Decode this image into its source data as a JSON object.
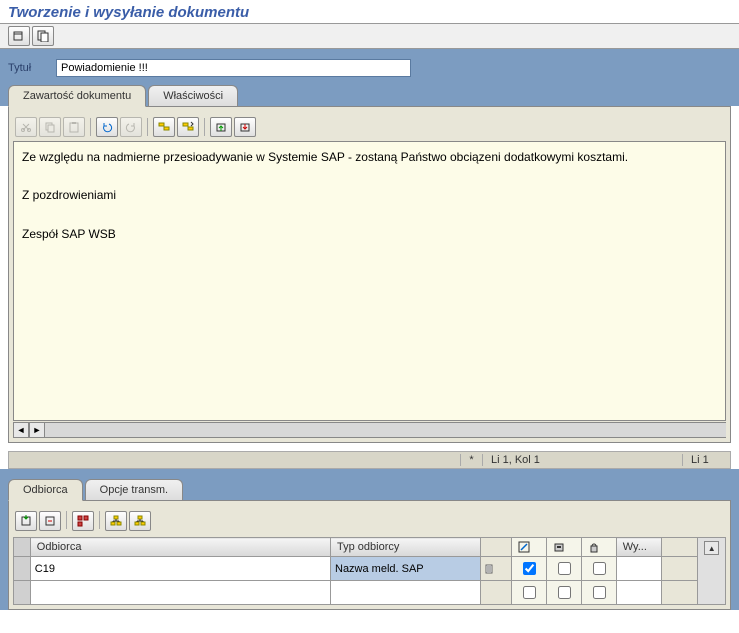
{
  "title": "Tworzenie i wysyłanie dokumentu",
  "header": {
    "title_label": "Tytuł",
    "title_value": "Powiadomienie !!!"
  },
  "tabs_upper": {
    "content": "Zawartość dokumentu",
    "properties": "Właściwości"
  },
  "editor": {
    "body": "Ze względu na nadmierne przesioadywanie w Systemie SAP - zostaną Państwo obciązeni dodatkowymi kosztami.\n\nZ pozdrowieniami\n\nZespół SAP WSB"
  },
  "status": {
    "modified": "*",
    "pos": "Li 1, Kol 1",
    "lines": "Li 1"
  },
  "tabs_lower": {
    "recipient": "Odbiorca",
    "trans_opts": "Opcje transm."
  },
  "recipient_grid": {
    "headers": {
      "recipient": "Odbiorca",
      "type": "Typ odbiorcy",
      "send": "Wy..."
    },
    "rows": [
      {
        "recipient": "C19",
        "type": "Nazwa meld. SAP",
        "flag1": true,
        "flag2": false,
        "flag3": false
      }
    ]
  }
}
